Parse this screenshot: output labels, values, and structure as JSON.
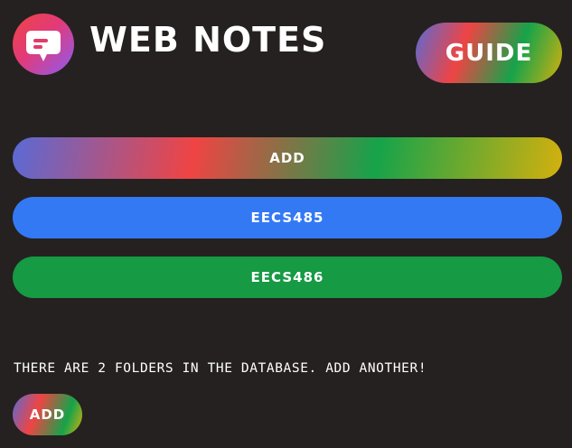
{
  "header": {
    "title": "WEB NOTES",
    "guide_label": "GUIDE",
    "logo_icon": "chat-bubble-icon"
  },
  "folders": [
    {
      "label": "ADD",
      "color": "gradient"
    },
    {
      "label": "EECS485",
      "color": "#3479f4"
    },
    {
      "label": "EECS486",
      "color": "#169a44"
    }
  ],
  "footer": {
    "status_text": "THERE ARE 2 FOLDERS IN THE DATABASE. ADD ANOTHER!",
    "add_label": "ADD"
  },
  "colors": {
    "background": "#252120",
    "blue": "#3479f4",
    "green": "#169a44",
    "red": "#ef4444",
    "yellow": "#d4b00e",
    "purple": "#8b5cf6"
  }
}
